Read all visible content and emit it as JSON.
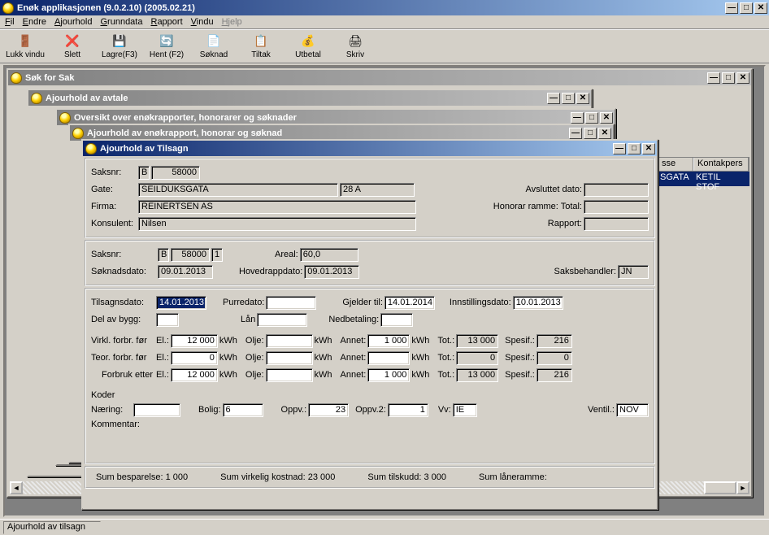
{
  "app": {
    "title": "Enøk applikasjonen  (9.0.2.10) (2005.02.21)",
    "menu": [
      "Fil",
      "Endre",
      "Ajourhold",
      "Grunndata",
      "Rapport",
      "Vindu",
      "Hjelp"
    ],
    "status": "Ajourhold av tilsagn"
  },
  "toolbar": [
    {
      "label": "Lukk vindu",
      "icon": "🚪"
    },
    {
      "label": "Slett",
      "icon": "❌"
    },
    {
      "label": "Lagre(F3)",
      "icon": "💾"
    },
    {
      "label": "Hent (F2)",
      "icon": "🔄"
    },
    {
      "label": "Søknad",
      "icon": "📄"
    },
    {
      "label": "Tiltak",
      "icon": "📋"
    },
    {
      "label": "Utbetal",
      "icon": "💰"
    },
    {
      "label": "Skriv",
      "icon": "🖨"
    }
  ],
  "windows": {
    "sok_sak": "Søk for Sak",
    "ajourhold_avtale": "Ajourhold av avtale",
    "oversikt": "Oversikt over enøkrapporter, honorarer og søknader",
    "ajourhold_rapport": "Ajourhold av enøkrapport, honorar og søknad",
    "tilsagn_title": "Ajourhold av Tilsagn"
  },
  "table_cols": {
    "sse": "sse",
    "kontakt": "Kontakpers"
  },
  "table_row": {
    "gata": "SGATA",
    "person": "KETIL STOF"
  },
  "tilsagn": {
    "top": {
      "saksnr_lbl": "Saksnr:",
      "saksnr_b": "B",
      "saksnr_n": "58000",
      "gate_lbl": "Gate:",
      "gate": "SEILDUKSGATA",
      "gate_no": "28 A",
      "avsluttet_lbl": "Avsluttet dato:",
      "avsluttet": "",
      "firma_lbl": "Firma:",
      "firma": "REINERTSEN AS",
      "honorar_lbl": "Honorar ramme: Total:",
      "honorar": "",
      "konsulent_lbl": "Konsulent:",
      "konsulent": "Nilsen",
      "rapport_lbl": "Rapport:",
      "rapport": ""
    },
    "mid": {
      "saksnr_lbl": "Saksnr:",
      "b": "B",
      "n": "58000",
      "seq": "1",
      "areal_lbl": "Areal:",
      "areal": "60,0",
      "soknad_lbl": "Søknadsdato:",
      "soknad": "09.01.2013",
      "hovedrapp_lbl": "Hovedrappdato:",
      "hovedrapp": "09.01.2013",
      "saksbeh_lbl": "Saksbehandler:",
      "saksbeh": "JN"
    },
    "main": {
      "tilsagnsdato_lbl": "Tilsagnsdato:",
      "tilsagnsdato": "14.01.2013",
      "purredato_lbl": "Purredato:",
      "purredato": "",
      "gjelder_lbl": "Gjelder til:",
      "gjelder": "14.01.2014",
      "innstilling_lbl": "Innstillingsdato:",
      "innstilling": "10.01.2013",
      "del_lbl": "Del av bygg:",
      "del": "",
      "lan_lbl": "Lån",
      "lan": "",
      "nedbet_lbl": "Nedbetaling:",
      "nedbet": "",
      "row1_lbl": "Virkl. forbr. før",
      "row2_lbl": "Teor. forbr. før",
      "row3_lbl": "Forbruk etter",
      "el_lbl": "El.:",
      "olje_lbl": "Olje:",
      "annet_lbl": "Annet:",
      "tot_lbl": "Tot.:",
      "spesif_lbl": "Spesif.:",
      "kwh": "kWh",
      "r1_el": "12 000",
      "r1_olje": "",
      "r1_annet": "1 000",
      "r1_tot": "13 000",
      "r1_spesif": "216",
      "r2_el": "0",
      "r2_olje": "",
      "r2_annet": "",
      "r2_tot": "0",
      "r2_spesif": "0",
      "r3_el": "12 000",
      "r3_olje": "",
      "r3_annet": "1 000",
      "r3_tot": "13 000",
      "r3_spesif": "216",
      "koder_lbl": "Koder",
      "naering_lbl": "Næring:",
      "naering": "",
      "bolig_lbl": "Bolig:",
      "bolig": "6",
      "oppv_lbl": "Oppv.:",
      "oppv": "23",
      "oppv2_lbl": "Oppv.2:",
      "oppv2": "1",
      "vv_lbl": "Vv:",
      "vv": "IE",
      "ventil_lbl": "Ventil.:",
      "ventil": "NOV",
      "kommentar_lbl": "Kommentar:",
      "kommentar": ""
    },
    "sum": {
      "besparelse": "Sum besparelse: 1 000",
      "virkelig": "Sum virkelig kostnad:  23 000",
      "tilskudd": "Sum tilskudd:  3 000",
      "laneramme": "Sum låneramme:"
    }
  }
}
